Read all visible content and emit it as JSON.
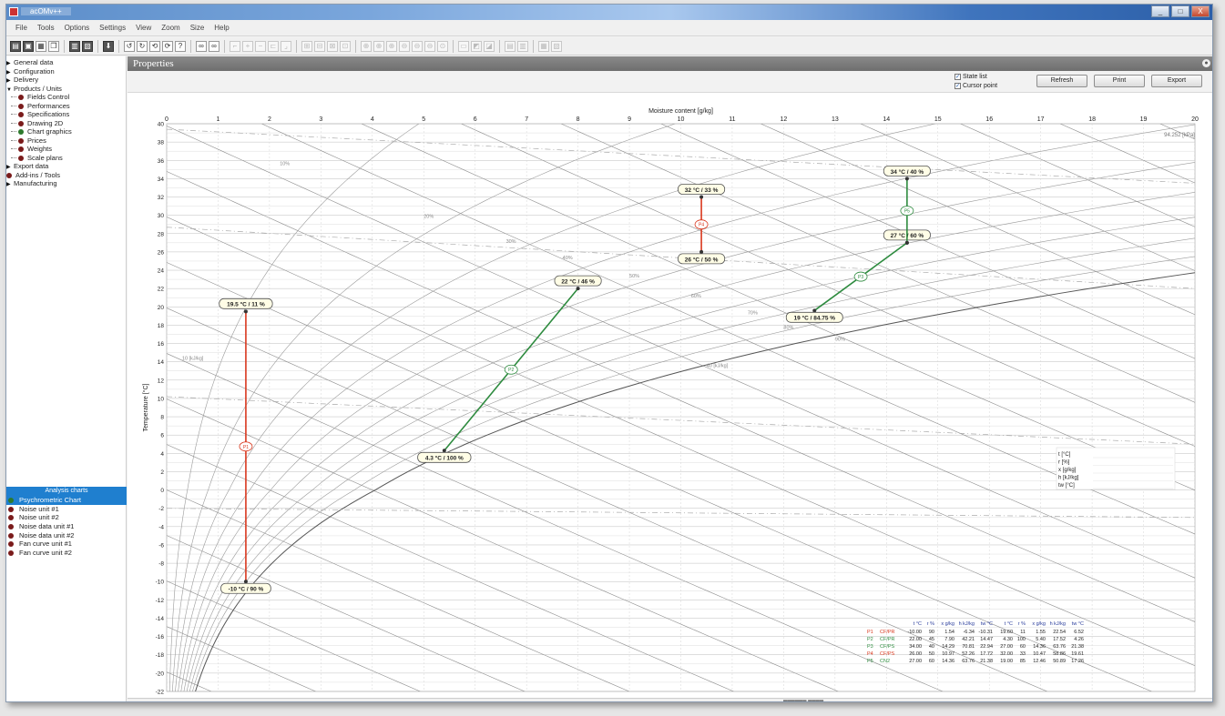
{
  "window": {
    "title": "acOMv++",
    "controls": {
      "minimize": "_",
      "maximize": "□",
      "close": "X"
    }
  },
  "menu": [
    "File",
    "Tools",
    "Options",
    "Settings",
    "View",
    "Zoom",
    "Size",
    "Help"
  ],
  "sidebar": {
    "tree": [
      {
        "label": "General data",
        "type": "collapsed",
        "level": 0
      },
      {
        "label": "Configuration",
        "type": "collapsed",
        "level": 0
      },
      {
        "label": "Delivery",
        "type": "collapsed",
        "level": 0
      },
      {
        "label": "Products / Units",
        "type": "expanded",
        "level": 0
      },
      {
        "label": "Fields Control",
        "type": "dot",
        "level": 1
      },
      {
        "label": "Performances",
        "type": "dot",
        "level": 1
      },
      {
        "label": "Specifications",
        "type": "dot",
        "level": 1
      },
      {
        "label": "Drawing 2D",
        "type": "dot",
        "level": 1
      },
      {
        "label": "Chart graphics",
        "type": "dot-green",
        "level": 1
      },
      {
        "label": "Prices",
        "type": "dot",
        "level": 1
      },
      {
        "label": "Weights",
        "type": "dot",
        "level": 1
      },
      {
        "label": "Scale plans",
        "type": "dot",
        "level": 1
      },
      {
        "label": "Export data",
        "type": "collapsed",
        "level": 0
      },
      {
        "label": "Add-ins / Tools",
        "type": "dot",
        "level": 0
      },
      {
        "label": "Manufacturing",
        "type": "collapsed",
        "level": 0
      }
    ],
    "analysis_header": "Analysis charts",
    "analysis_items": [
      {
        "label": "Psychrometric Chart",
        "selected": true
      },
      {
        "label": "Noise unit #1",
        "selected": false
      },
      {
        "label": "Noise unit #2",
        "selected": false
      },
      {
        "label": "Noise data unit #1",
        "selected": false
      },
      {
        "label": "Noise data unit #2",
        "selected": false
      },
      {
        "label": "Fan curve unit #1",
        "selected": false
      },
      {
        "label": "Fan curve unit #2",
        "selected": false
      }
    ]
  },
  "properties": {
    "title": "Properties",
    "pin_icon": "pin-icon"
  },
  "controls": {
    "check_state": "State list",
    "check_cursor": "Cursor point",
    "refresh": "Refresh",
    "print": "Print",
    "export": "Export"
  },
  "chart_data": {
    "type": "psychrometric",
    "xlabel": "Moisture content [g/kg]",
    "ylabel": "Temperature [°C]",
    "xlim": [
      0,
      20
    ],
    "ylim": [
      -22,
      40
    ],
    "x_ticks": [
      "0",
      "1",
      "2",
      "3",
      "4",
      "5",
      "6",
      "7",
      "8",
      "9",
      "10",
      "11",
      "12",
      "13",
      "14",
      "15",
      "16",
      "17",
      "18",
      "19",
      "20"
    ],
    "y_ticks": [
      "40",
      "38",
      "36",
      "34",
      "32",
      "30",
      "28",
      "26",
      "24",
      "22",
      "20",
      "18",
      "16",
      "14",
      "12",
      "10",
      "8",
      "6",
      "4",
      "2",
      "0",
      "-2",
      "-4",
      "-6",
      "-8",
      "-10",
      "-12",
      "-14",
      "-16",
      "-18",
      "-20",
      "-22"
    ],
    "pressure_label": "94.252 [kPa]",
    "enthalpy_label": "40 [kJ/kg]",
    "wet_bulb_label": "10 [kJ/kg]",
    "rh_labels": [
      "10%",
      "20%",
      "30%",
      "40%",
      "50%",
      "60%",
      "70%",
      "80%",
      "90%"
    ],
    "processes": [
      {
        "name": "P1",
        "color": "#d9381e",
        "start": {
          "x": 1.54,
          "y": 19.5,
          "label": "19.5 °C / 11 %"
        },
        "end": {
          "x": 1.54,
          "y": -10,
          "label": "-10 °C / 90 %"
        }
      },
      {
        "name": "P2",
        "color": "#2e8b3f",
        "start": {
          "x": 5.4,
          "y": 4.3,
          "label": "4.3 °C / 100 %"
        },
        "end": {
          "x": 8.0,
          "y": 22.0,
          "label": "22 °C / 46 %"
        }
      },
      {
        "name": "P3",
        "color": "#2e8b3f",
        "start": {
          "x": 12.6,
          "y": 19.6,
          "label": "19 °C / 84.75 %"
        },
        "end": {
          "x": 14.4,
          "y": 27.0,
          "label": "27 °C / 60 %"
        }
      },
      {
        "name": "P4",
        "color": "#d9381e",
        "start": {
          "x": 10.4,
          "y": 32.0,
          "label": "32 °C / 33 %"
        },
        "end": {
          "x": 10.4,
          "y": 26.0,
          "label": "26 °C / 50 %"
        }
      },
      {
        "name": "P5",
        "color": "#2e8b3f",
        "start": {
          "x": 14.4,
          "y": 27.0,
          "label": ""
        },
        "end": {
          "x": 14.4,
          "y": 34.0,
          "label": "34 °C / 40 %"
        }
      }
    ],
    "cursor_panel": [
      "t [°C]",
      "r [%]",
      "x [g/kg]",
      "h [kJ/kg]",
      "tw [°C]"
    ],
    "table": {
      "headers": [
        "",
        "",
        "t °C",
        "r %",
        "x g/kg",
        "h kJ/kg",
        "tw °C",
        "t °C",
        "r %",
        "x g/kg",
        "h kJ/kg",
        "tw °C"
      ],
      "rows": [
        [
          "P1",
          "CF/PR",
          "-10.00",
          "90",
          "1.54",
          "-6.34",
          "-10.31",
          "19.60",
          "11",
          "1.55",
          "22.54",
          "6.52"
        ],
        [
          "P2",
          "CF/PR",
          "22.00",
          "45",
          "7.90",
          "42.21",
          "14.47",
          "4.30",
          "100",
          "5.40",
          "17.52",
          "4.26"
        ],
        [
          "P3",
          "CF/PS",
          "34.00",
          "40",
          "14.29",
          "70.81",
          "22.94",
          "27.00",
          "60",
          "14.36",
          "63.76",
          "21.38"
        ],
        [
          "P4",
          "CF/PS",
          "26.00",
          "50",
          "10.97",
          "52.26",
          "17.72",
          "32.00",
          "33",
          "10.47",
          "58.86",
          "19.61"
        ],
        [
          "P5",
          "CN2",
          "27.00",
          "60",
          "14.36",
          "63.76",
          "21.38",
          "19.00",
          "85",
          "12.46",
          "50.89",
          "17.26"
        ]
      ],
      "row_colors": [
        "#d9381e",
        "#2e8b3f",
        "#2e8b3f",
        "#d9381e",
        "#2e8b3f"
      ]
    }
  },
  "status": {
    "text": "▄▄▄▄▄▄ ▄▄▄▄"
  }
}
